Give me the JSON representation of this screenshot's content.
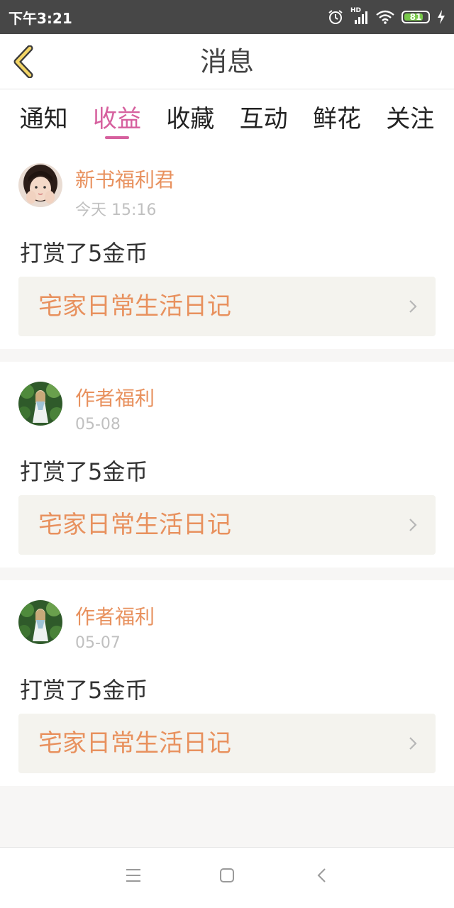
{
  "status": {
    "time": "下午3:21",
    "battery": "81",
    "battery_level": 0.81,
    "network_label": "HD"
  },
  "header": {
    "title": "消息"
  },
  "tabs": [
    {
      "label": "通知",
      "active": false
    },
    {
      "label": "收益",
      "active": true
    },
    {
      "label": "收藏",
      "active": false
    },
    {
      "label": "互动",
      "active": false
    },
    {
      "label": "鲜花",
      "active": false
    },
    {
      "label": "关注",
      "active": false
    }
  ],
  "messages": [
    {
      "sender": "新书福利君",
      "time": "今天 15:16",
      "text": "打赏了5金币",
      "book": "宅家日常生活日记"
    },
    {
      "sender": "作者福利",
      "time": "05-08",
      "text": "打赏了5金币",
      "book": "宅家日常生活日记"
    },
    {
      "sender": "作者福利",
      "time": "05-07",
      "text": "打赏了5金币",
      "book": "宅家日常生活日记"
    }
  ],
  "colors": {
    "accent": "#d6609e",
    "link_orange": "#e8915e",
    "status_bar": "#474747",
    "book_bg": "#f4f3ee"
  },
  "icons": {
    "back": "back-chevron-icon",
    "alarm": "alarm-icon",
    "signal": "signal-icon",
    "wifi": "wifi-icon",
    "battery": "battery-icon",
    "charging": "charging-icon",
    "nav_menu": "menu-icon",
    "nav_home": "home-icon",
    "nav_back": "back-icon"
  }
}
